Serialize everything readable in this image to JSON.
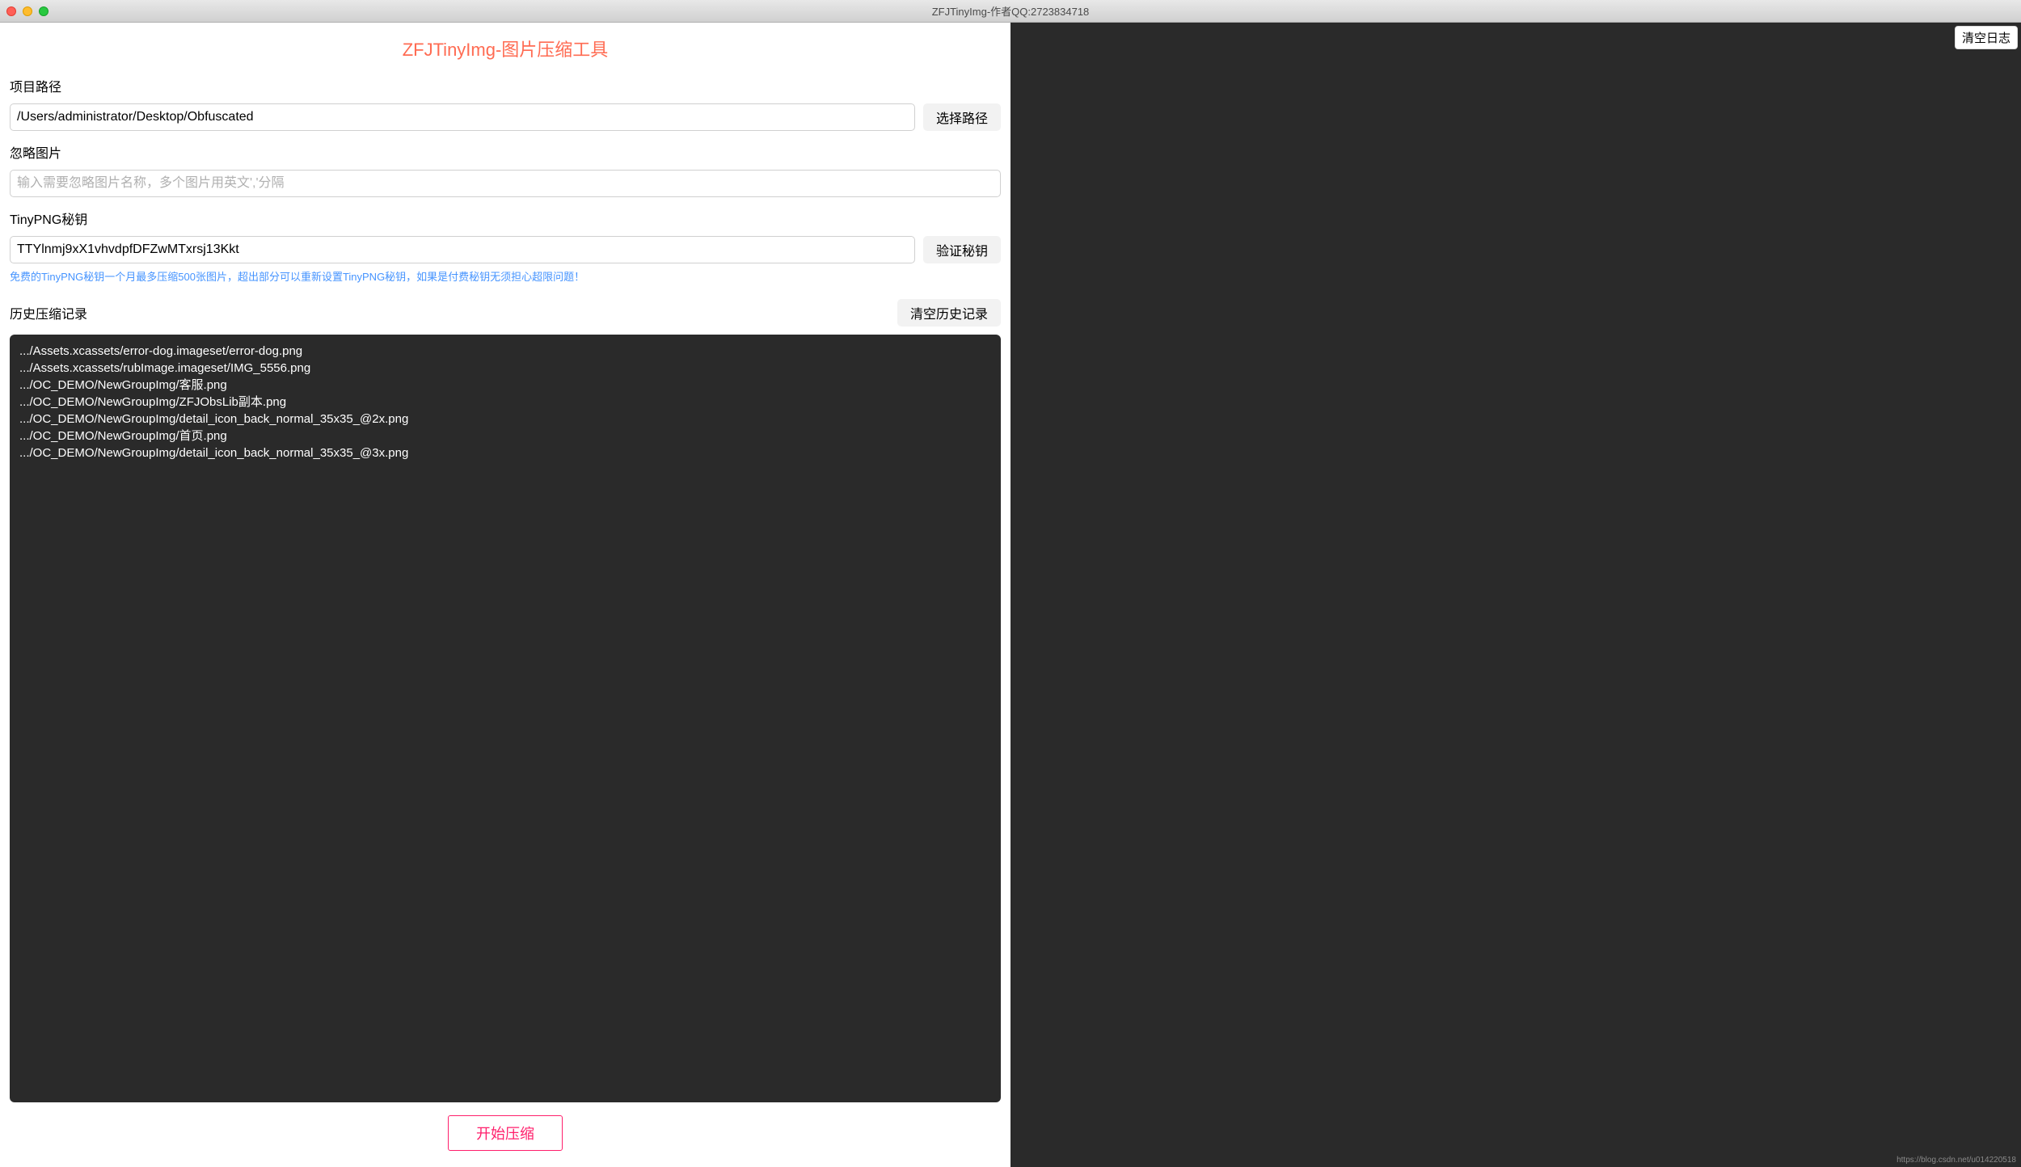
{
  "window": {
    "title": "ZFJTinyImg-作者QQ:2723834718"
  },
  "app_title": "ZFJTinyImg-图片压缩工具",
  "project_path": {
    "label": "项目路径",
    "value": "/Users/administrator/Desktop/Obfuscated",
    "button": "选择路径"
  },
  "ignore_images": {
    "label": "忽略图片",
    "placeholder": "输入需要忽略图片名称，多个图片用英文','分隔",
    "value": ""
  },
  "tinypng_key": {
    "label": "TinyPNG秘钥",
    "value": "TTYlnmj9xX1vhvdpfDFZwMTxrsj13Kkt",
    "button": "验证秘钥",
    "hint": "免费的TinyPNG秘钥一个月最多压缩500张图片，超出部分可以重新设置TinyPNG秘钥，如果是付费秘钥无须担心超限问题！"
  },
  "history": {
    "label": "历史压缩记录",
    "clear_button": "清空历史记录",
    "items": [
      ".../Assets.xcassets/error-dog.imageset/error-dog.png",
      ".../Assets.xcassets/rubImage.imageset/IMG_5556.png",
      ".../OC_DEMO/NewGroupImg/客服.png",
      ".../OC_DEMO/NewGroupImg/ZFJObsLib副本.png",
      ".../OC_DEMO/NewGroupImg/detail_icon_back_normal_35x35_@2x.png",
      ".../OC_DEMO/NewGroupImg/首页.png",
      ".../OC_DEMO/NewGroupImg/detail_icon_back_normal_35x35_@3x.png"
    ]
  },
  "start_button": "开始压缩",
  "right_panel": {
    "clear_log_button": "清空日志"
  },
  "watermark": "https://blog.csdn.net/u014220518"
}
